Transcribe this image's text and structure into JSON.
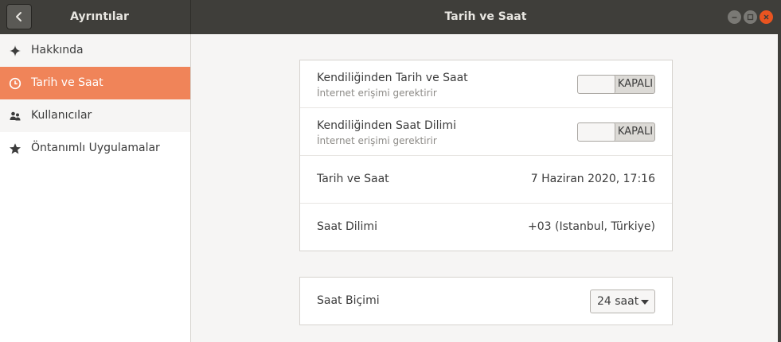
{
  "header": {
    "left_title": "Ayrıntılar",
    "title": "Tarih ve Saat"
  },
  "sidebar": {
    "items": [
      {
        "label": "Hakkında",
        "icon": "sparkle-icon",
        "selected": false
      },
      {
        "label": "Tarih ve Saat",
        "icon": "clock-icon",
        "selected": true
      },
      {
        "label": "Kullanıcılar",
        "icon": "users-icon",
        "selected": false
      },
      {
        "label": "Öntanımlı Uygulamalar",
        "icon": "star-icon",
        "selected": false
      }
    ]
  },
  "datetime": {
    "auto_time": {
      "title": "Kendiliğinden Tarih ve Saat",
      "subtitle": "İnternet erişimi gerektirir",
      "state": "KAPALI"
    },
    "auto_timezone": {
      "title": "Kendiliğinden Saat Dilimi",
      "subtitle": "İnternet erişimi gerektirir",
      "state": "KAPALI"
    },
    "date_time": {
      "label": "Tarih ve Saat",
      "value": "7 Haziran 2020, 17:16"
    },
    "timezone": {
      "label": "Saat Dilimi",
      "value": "+03 (Istanbul, Türkiye)"
    }
  },
  "format": {
    "label": "Saat Biçimi",
    "selected": "24 saat"
  },
  "colors": {
    "accent": "#f08459",
    "header_bg": "#3f3e3a",
    "close_button": "#e95420"
  }
}
